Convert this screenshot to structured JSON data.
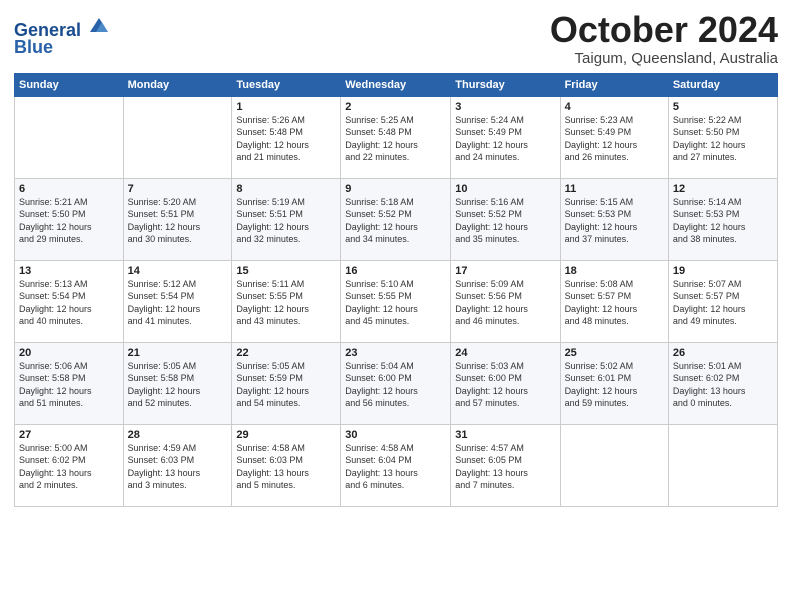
{
  "header": {
    "logo_line1": "General",
    "logo_line2": "Blue",
    "month_title": "October 2024",
    "location": "Taigum, Queensland, Australia"
  },
  "days_of_week": [
    "Sunday",
    "Monday",
    "Tuesday",
    "Wednesday",
    "Thursday",
    "Friday",
    "Saturday"
  ],
  "weeks": [
    [
      {
        "day": "",
        "info": ""
      },
      {
        "day": "",
        "info": ""
      },
      {
        "day": "1",
        "info": "Sunrise: 5:26 AM\nSunset: 5:48 PM\nDaylight: 12 hours\nand 21 minutes."
      },
      {
        "day": "2",
        "info": "Sunrise: 5:25 AM\nSunset: 5:48 PM\nDaylight: 12 hours\nand 22 minutes."
      },
      {
        "day": "3",
        "info": "Sunrise: 5:24 AM\nSunset: 5:49 PM\nDaylight: 12 hours\nand 24 minutes."
      },
      {
        "day": "4",
        "info": "Sunrise: 5:23 AM\nSunset: 5:49 PM\nDaylight: 12 hours\nand 26 minutes."
      },
      {
        "day": "5",
        "info": "Sunrise: 5:22 AM\nSunset: 5:50 PM\nDaylight: 12 hours\nand 27 minutes."
      }
    ],
    [
      {
        "day": "6",
        "info": "Sunrise: 5:21 AM\nSunset: 5:50 PM\nDaylight: 12 hours\nand 29 minutes."
      },
      {
        "day": "7",
        "info": "Sunrise: 5:20 AM\nSunset: 5:51 PM\nDaylight: 12 hours\nand 30 minutes."
      },
      {
        "day": "8",
        "info": "Sunrise: 5:19 AM\nSunset: 5:51 PM\nDaylight: 12 hours\nand 32 minutes."
      },
      {
        "day": "9",
        "info": "Sunrise: 5:18 AM\nSunset: 5:52 PM\nDaylight: 12 hours\nand 34 minutes."
      },
      {
        "day": "10",
        "info": "Sunrise: 5:16 AM\nSunset: 5:52 PM\nDaylight: 12 hours\nand 35 minutes."
      },
      {
        "day": "11",
        "info": "Sunrise: 5:15 AM\nSunset: 5:53 PM\nDaylight: 12 hours\nand 37 minutes."
      },
      {
        "day": "12",
        "info": "Sunrise: 5:14 AM\nSunset: 5:53 PM\nDaylight: 12 hours\nand 38 minutes."
      }
    ],
    [
      {
        "day": "13",
        "info": "Sunrise: 5:13 AM\nSunset: 5:54 PM\nDaylight: 12 hours\nand 40 minutes."
      },
      {
        "day": "14",
        "info": "Sunrise: 5:12 AM\nSunset: 5:54 PM\nDaylight: 12 hours\nand 41 minutes."
      },
      {
        "day": "15",
        "info": "Sunrise: 5:11 AM\nSunset: 5:55 PM\nDaylight: 12 hours\nand 43 minutes."
      },
      {
        "day": "16",
        "info": "Sunrise: 5:10 AM\nSunset: 5:55 PM\nDaylight: 12 hours\nand 45 minutes."
      },
      {
        "day": "17",
        "info": "Sunrise: 5:09 AM\nSunset: 5:56 PM\nDaylight: 12 hours\nand 46 minutes."
      },
      {
        "day": "18",
        "info": "Sunrise: 5:08 AM\nSunset: 5:57 PM\nDaylight: 12 hours\nand 48 minutes."
      },
      {
        "day": "19",
        "info": "Sunrise: 5:07 AM\nSunset: 5:57 PM\nDaylight: 12 hours\nand 49 minutes."
      }
    ],
    [
      {
        "day": "20",
        "info": "Sunrise: 5:06 AM\nSunset: 5:58 PM\nDaylight: 12 hours\nand 51 minutes."
      },
      {
        "day": "21",
        "info": "Sunrise: 5:05 AM\nSunset: 5:58 PM\nDaylight: 12 hours\nand 52 minutes."
      },
      {
        "day": "22",
        "info": "Sunrise: 5:05 AM\nSunset: 5:59 PM\nDaylight: 12 hours\nand 54 minutes."
      },
      {
        "day": "23",
        "info": "Sunrise: 5:04 AM\nSunset: 6:00 PM\nDaylight: 12 hours\nand 56 minutes."
      },
      {
        "day": "24",
        "info": "Sunrise: 5:03 AM\nSunset: 6:00 PM\nDaylight: 12 hours\nand 57 minutes."
      },
      {
        "day": "25",
        "info": "Sunrise: 5:02 AM\nSunset: 6:01 PM\nDaylight: 12 hours\nand 59 minutes."
      },
      {
        "day": "26",
        "info": "Sunrise: 5:01 AM\nSunset: 6:02 PM\nDaylight: 13 hours\nand 0 minutes."
      }
    ],
    [
      {
        "day": "27",
        "info": "Sunrise: 5:00 AM\nSunset: 6:02 PM\nDaylight: 13 hours\nand 2 minutes."
      },
      {
        "day": "28",
        "info": "Sunrise: 4:59 AM\nSunset: 6:03 PM\nDaylight: 13 hours\nand 3 minutes."
      },
      {
        "day": "29",
        "info": "Sunrise: 4:58 AM\nSunset: 6:03 PM\nDaylight: 13 hours\nand 5 minutes."
      },
      {
        "day": "30",
        "info": "Sunrise: 4:58 AM\nSunset: 6:04 PM\nDaylight: 13 hours\nand 6 minutes."
      },
      {
        "day": "31",
        "info": "Sunrise: 4:57 AM\nSunset: 6:05 PM\nDaylight: 13 hours\nand 7 minutes."
      },
      {
        "day": "",
        "info": ""
      },
      {
        "day": "",
        "info": ""
      }
    ]
  ]
}
